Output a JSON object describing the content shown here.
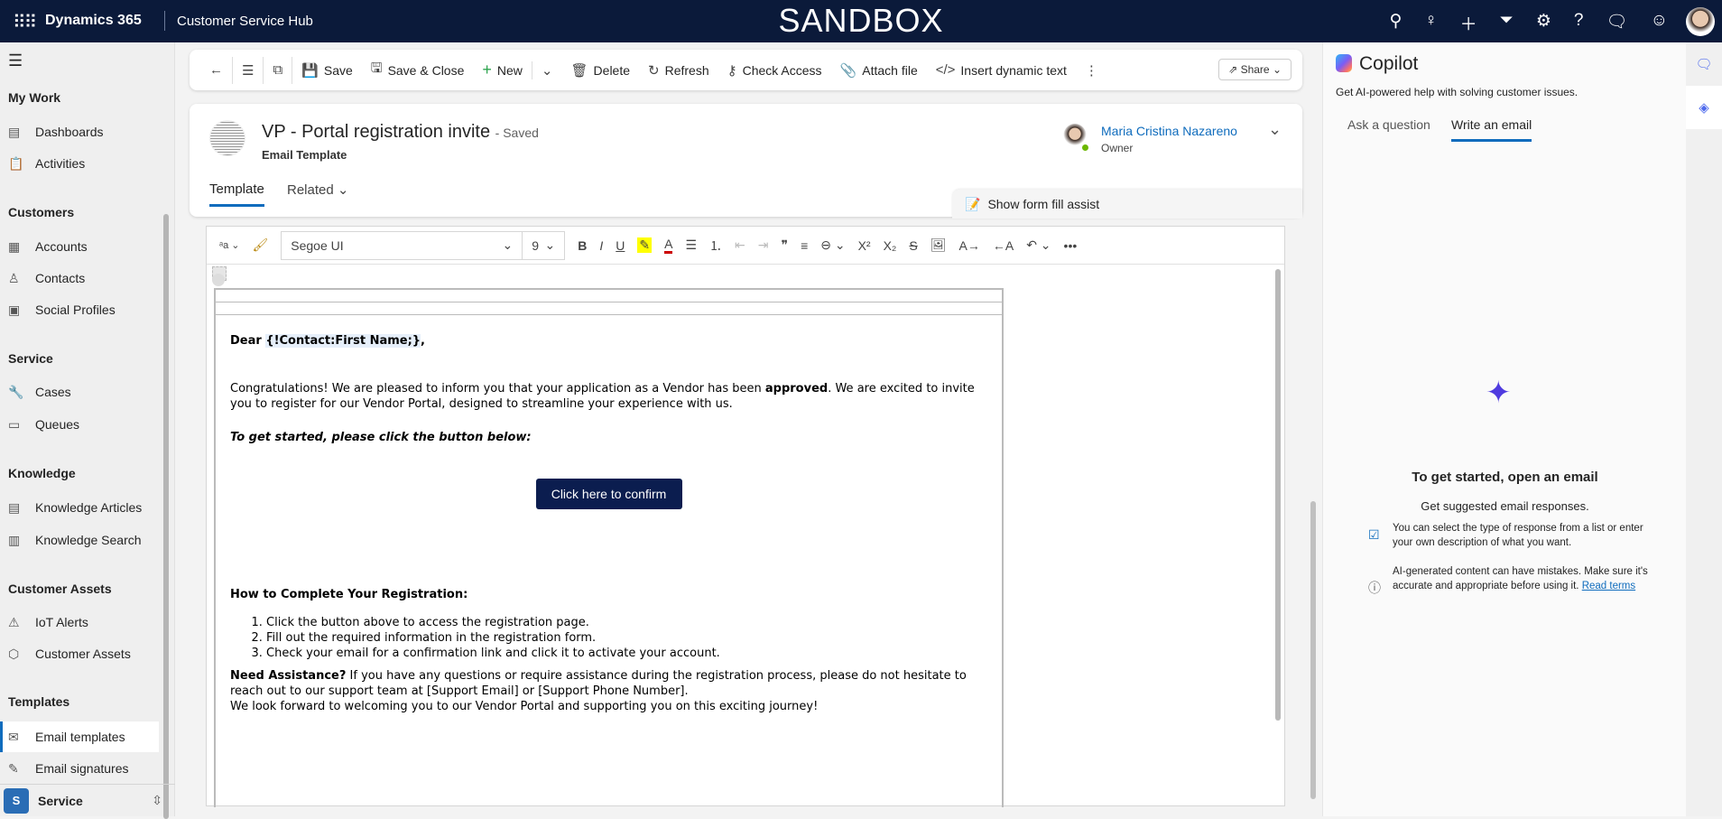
{
  "topbar": {
    "brand": "Dynamics 365",
    "app": "Customer Service Hub",
    "environment": "SANDBOX",
    "icons": [
      "search-icon",
      "lightbulb-icon",
      "plus-icon",
      "filter-icon",
      "settings-icon",
      "help-icon",
      "chat-icon",
      "feedback-icon"
    ]
  },
  "sidebar": {
    "groups": [
      {
        "title": "My Work",
        "items": [
          "Dashboards",
          "Activities"
        ]
      },
      {
        "title": "Customers",
        "items": [
          "Accounts",
          "Contacts",
          "Social Profiles"
        ]
      },
      {
        "title": "Service",
        "items": [
          "Cases",
          "Queues"
        ]
      },
      {
        "title": "Knowledge",
        "items": [
          "Knowledge Articles",
          "Knowledge Search"
        ]
      },
      {
        "title": "Customer Assets",
        "items": [
          "IoT Alerts",
          "Customer Assets"
        ]
      },
      {
        "title": "Templates",
        "items": [
          "Email templates",
          "Email signatures"
        ]
      }
    ],
    "active": "Email templates",
    "area_initial": "S",
    "area": "Service"
  },
  "commands": {
    "save": "Save",
    "save_close": "Save & Close",
    "new": "New",
    "delete": "Delete",
    "refresh": "Refresh",
    "check_access": "Check Access",
    "attach": "Attach file",
    "insert_dynamic": "Insert dynamic text",
    "share": "Share"
  },
  "record": {
    "title": "VP - Portal registration invite",
    "status": "- Saved",
    "entity": "Email Template",
    "owner_name": "Maria Cristina Nazareno",
    "owner_label": "Owner",
    "tabs": [
      "Template",
      "Related"
    ],
    "form_fill": "Show form fill assist"
  },
  "editor": {
    "font": "Segoe UI",
    "size": "9"
  },
  "email": {
    "greeting": "Dear ",
    "placeholder": "{!Contact:First Name;}",
    "greeting_end": ",",
    "p1a": "Congratulations! We are pleased to inform you that your application as a Vendor has been ",
    "p1b": "approved",
    "p1c": ". We are excited to invite you to register for our Vendor Portal, designed to streamline your experience with us.",
    "cta_intro": "To get started, please click the button below:",
    "cta": "Click here to confirm",
    "how_title": "How to Complete Your Registration:",
    "steps": [
      "Click the button above to access the registration page.",
      "Fill out the required information in the registration form.",
      "Check your email for a confirmation link and click it to activate your account."
    ],
    "assist_title": "Need Assistance?",
    "assist_text": " If you have any questions or require assistance during the registration process, please do not hesitate to reach out to our support team at [Support Email] or [Support Phone Number].",
    "closing": "We look forward to welcoming you to our Vendor Portal and supporting you on this exciting journey!"
  },
  "copilot": {
    "title": "Copilot",
    "subtitle": "Get AI-powered help with solving customer issues.",
    "tabs": [
      "Ask a question",
      "Write an email"
    ],
    "heading": "To get started, open an email",
    "subheading": "Get suggested email responses.",
    "note1": "You can select the type of response from a list or enter your own description of what you want.",
    "note2": "AI-generated content can have mistakes. Make sure it's accurate and appropriate before using it. ",
    "read_terms": "Read terms"
  }
}
